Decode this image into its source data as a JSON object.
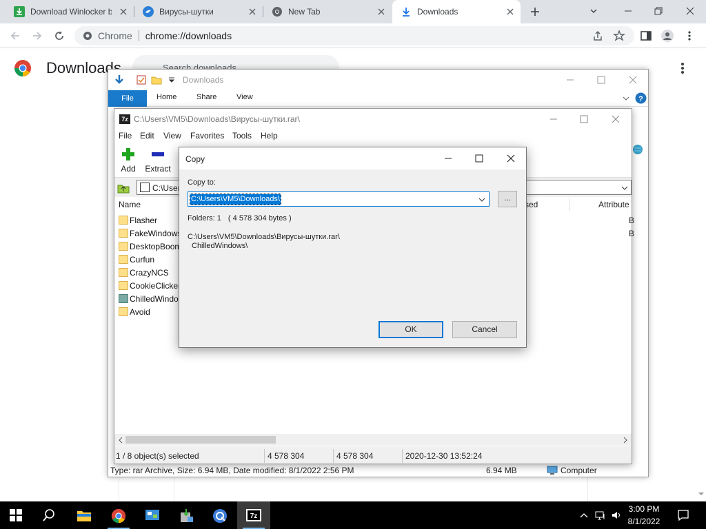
{
  "chrome": {
    "tabs": [
      {
        "label": "Download Winlocker b",
        "active": false
      },
      {
        "label": "Вирусы-шутки",
        "active": false
      },
      {
        "label": "New Tab",
        "active": false
      },
      {
        "label": "Downloads",
        "active": true
      }
    ],
    "omnibox": {
      "site_label": "Chrome",
      "url": "chrome://downloads"
    }
  },
  "downloads_page": {
    "title": "Downloads",
    "search_placeholder": "Search downloads"
  },
  "explorer": {
    "title": "Downloads",
    "ribbon_tabs": [
      "File",
      "Home",
      "Share",
      "View"
    ],
    "status_left": "Type: rar Archive, Size: 6.94 MB, Date modified: 8/1/2022 2:56 PM",
    "status_size": "6.94 MB",
    "status_location": "Computer"
  },
  "sevenzip": {
    "title": "C:\\Users\\VM5\\Downloads\\Вирусы-шутки.rar\\",
    "menu": [
      "File",
      "Edit",
      "View",
      "Favorites",
      "Tools",
      "Help"
    ],
    "tools": {
      "add": "Add",
      "extract": "Extract"
    },
    "path_value": "C:\\User",
    "columns": {
      "name": "Name",
      "modified": "sed",
      "attributes": "Attribute"
    },
    "files": [
      {
        "name": "Flasher",
        "type": "folder",
        "attr": "B"
      },
      {
        "name": "FakeWindows",
        "type": "folder",
        "attr": "B"
      },
      {
        "name": "DesktopBoom",
        "type": "folder",
        "attr": ""
      },
      {
        "name": "Curfun",
        "type": "folder",
        "attr": ""
      },
      {
        "name": "CrazyNCS",
        "type": "folder",
        "attr": ""
      },
      {
        "name": "CookieClicker",
        "type": "folder",
        "attr": ""
      },
      {
        "name": "ChilledWindo",
        "type": "archive",
        "attr": ""
      },
      {
        "name": "Avoid",
        "type": "folder",
        "attr": ""
      }
    ],
    "status": {
      "selection": "1 / 8 object(s) selected",
      "size": "4 578 304",
      "packed": "4 578 304",
      "date": "2020-12-30 13:52:24"
    }
  },
  "copy_dialog": {
    "title": "Copy",
    "copy_to_label": "Copy to:",
    "copy_to_value": "C:\\Users\\VM5\\Downloads\\",
    "browse_label": "...",
    "folders_label": "Folders: 1",
    "bytes_label": "( 4 578 304 bytes )",
    "source_path_line1": "C:\\Users\\VM5\\Downloads\\Вирусы-шутки.rar\\",
    "source_path_line2": "ChilledWindows\\",
    "ok_label": "OK",
    "cancel_label": "Cancel"
  },
  "taskbar": {
    "time": "3:00 PM",
    "date": "8/1/2022",
    "accent": "#0078d7"
  }
}
